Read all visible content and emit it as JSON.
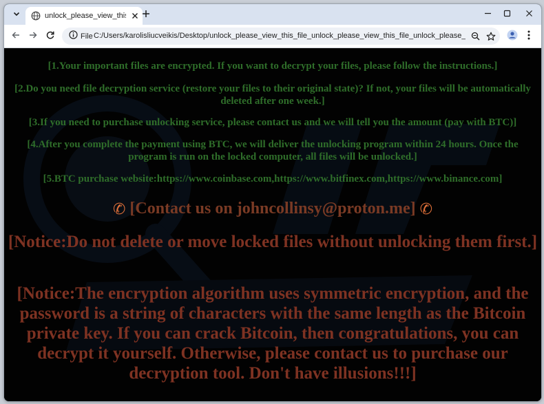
{
  "browser": {
    "tab": {
      "title": "unlock_please_view_this_file_unlock_please_view_this_file_unlock_please_view_this_file.html",
      "favicon": "globe-icon"
    },
    "address_bar": {
      "site_info_label": "File",
      "url": "C:/Users/karolisliucveikis/Desktop/unlock_please_view_this_file_unlock_please_view_this_file_unlock_please_view_this_file.html"
    },
    "icons": {
      "tab_menu": "chevron-down-icon",
      "tab_close": "close-icon",
      "new_tab": "plus-icon",
      "minimize": "minimize-icon",
      "maximize": "maximize-icon",
      "close_window": "close-icon",
      "back": "back-arrow-icon",
      "forward": "forward-arrow-icon",
      "reload": "reload-icon",
      "info": "info-icon",
      "zoom": "zoom-icon",
      "bookmark": "star-icon",
      "profile": "profile-icon",
      "menu": "kebab-menu-icon"
    }
  },
  "page": {
    "colors": {
      "background": "#020202",
      "instructions": "#2f6e2a",
      "contact": "#7a3a24",
      "notice": "#7e3222"
    },
    "instructions": [
      "[1.Your important files are encrypted. If you want to decrypt your files, please follow the instructions.]",
      "[2.Do you need file decryption service (restore your files to their original state)? If not, your files will be automatically deleted after one week.]",
      "[3.If you need to purchase unlocking service, please contact us and we will tell you the amount (pay with BTC)]",
      "[4.After you complete the payment using BTC, we will deliver the unlocking program within 24 hours. Once the program is run on the locked computer, all files will be unlocked.]",
      "[5.BTC purchase website:https://www.coinbase.com,https://www.bitfinex.com,https://www.binance.com]"
    ],
    "contact": {
      "text": "[Contact us on johncollinsy@proton.me]",
      "icon": "telephone-icon"
    },
    "notices": [
      "[Notice:Do not delete or move locked files without unlocking them first.]",
      "[Notice:The encryption algorithm uses symmetric encryption, and the password is a string of characters with the same length as the Bitcoin private key. If you can crack Bitcoin, then congratulations, you can decrypt it yourself. Otherwise, please contact us to purchase our decryption tool. Don't have illusions!!!]"
    ]
  }
}
